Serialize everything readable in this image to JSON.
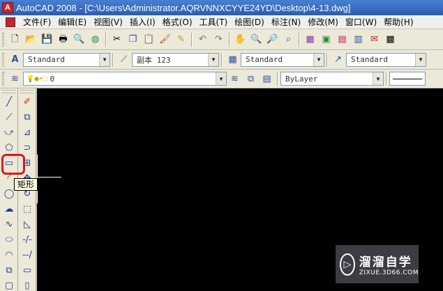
{
  "window": {
    "title": "AutoCAD 2008 - [C:\\Users\\Administrator.AQRVNNXCYYE24YD\\Desktop\\4-13.dwg]",
    "app_icon": "A"
  },
  "menu": {
    "items": [
      "文件(F)",
      "编辑(E)",
      "视图(V)",
      "插入(I)",
      "格式(O)",
      "工具(T)",
      "绘图(D)",
      "标注(N)",
      "修改(M)",
      "窗口(W)",
      "帮助(H)"
    ]
  },
  "toolbar_standard": {
    "icons": [
      "new-icon",
      "open-icon",
      "save-icon",
      "plot-icon",
      "plot-preview-icon",
      "publish-icon",
      "cut-icon",
      "copy-icon",
      "paste-icon",
      "match-properties-icon",
      "block-editor-icon",
      "undo-icon",
      "redo-icon",
      "pan-icon",
      "zoom-realtime-icon",
      "zoom-window-icon",
      "zoom-previous-icon",
      "properties-icon",
      "design-center-icon",
      "tool-palettes-icon",
      "sheet-set-icon",
      "markup-icon",
      "calculator-icon"
    ]
  },
  "toolbar_styles": {
    "text_style": "Standard",
    "dim_style": "副本 123",
    "table_style": "Standard",
    "multileader_style": "Standard"
  },
  "toolbar_layers": {
    "layer_name": "0",
    "color": "ByLayer"
  },
  "tooltip": {
    "text": "矩形"
  },
  "watermark": {
    "name": "溜溜自学",
    "url": "ZIXUE.3D66.COM"
  },
  "colors": {
    "canvas": "#000000",
    "highlight": "#e0161b",
    "tooltip_bg": "#ffffe1"
  }
}
